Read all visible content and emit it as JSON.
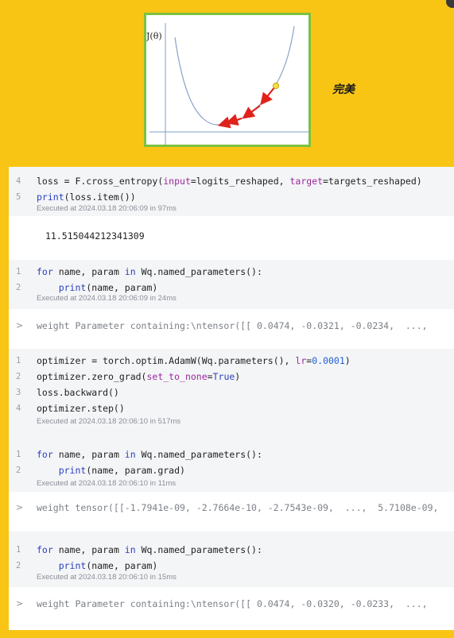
{
  "caption": "完美",
  "figure": {
    "axis_label": "J(θ)"
  },
  "cells": [
    {
      "lines": [
        {
          "n": "4",
          "tokens": [
            [
              "loss = F.cross_entropy(",
              ""
            ],
            [
              "input",
              "par"
            ],
            [
              "=logits_reshaped, ",
              ""
            ],
            [
              "target",
              "par"
            ],
            [
              "=targets_reshaped)",
              ""
            ]
          ]
        },
        {
          "n": "5",
          "tokens": [
            [
              "print",
              "fn"
            ],
            [
              "(loss.item())",
              ""
            ]
          ]
        }
      ],
      "meta": "Executed at 2024.03.18 20:06:09 in 97ms",
      "output": "11.515044212341309"
    },
    {
      "lines": [
        {
          "n": "1",
          "tokens": [
            [
              "for",
              "kw"
            ],
            [
              " name, param ",
              ""
            ],
            [
              "in",
              "kw"
            ],
            [
              " Wq.named_parameters():",
              ""
            ]
          ]
        },
        {
          "n": "2",
          "tokens": [
            [
              "    ",
              ""
            ],
            [
              "print",
              "fn"
            ],
            [
              "(name, param)",
              ""
            ]
          ]
        }
      ],
      "meta": "Executed at 2024.03.18 20:06:09 in 24ms",
      "output": "weight Parameter containing:\\ntensor([[ 0.0474, -0.0321, -0.0234,  ...,"
    },
    {
      "lines": [
        {
          "n": "1",
          "tokens": [
            [
              "optimizer = torch.optim.AdamW(Wq.parameters(), ",
              ""
            ],
            [
              "lr",
              "par"
            ],
            [
              "=",
              ""
            ],
            [
              "0.0001",
              "num"
            ],
            [
              ")",
              ""
            ]
          ]
        },
        {
          "n": "2",
          "tokens": [
            [
              "optimizer.zero_grad(",
              ""
            ],
            [
              "set_to_none",
              "par"
            ],
            [
              "=",
              ""
            ],
            [
              "True",
              "kw"
            ],
            [
              ")",
              ""
            ]
          ]
        },
        {
          "n": "3",
          "tokens": [
            [
              "loss.backward()",
              ""
            ]
          ]
        },
        {
          "n": "4",
          "tokens": [
            [
              "optimizer.step()",
              ""
            ]
          ]
        }
      ],
      "meta": "Executed at 2024.03.18 20:06:10 in 517ms",
      "output": ""
    },
    {
      "lines": [
        {
          "n": "1",
          "tokens": [
            [
              "for",
              "kw"
            ],
            [
              " name, param ",
              ""
            ],
            [
              "in",
              "kw"
            ],
            [
              " Wq.named_parameters():",
              ""
            ]
          ]
        },
        {
          "n": "2",
          "tokens": [
            [
              "    ",
              ""
            ],
            [
              "print",
              "fn"
            ],
            [
              "(name, param.grad)",
              ""
            ]
          ]
        }
      ],
      "meta": "Executed at 2024.03.18 20:06:10 in 11ms",
      "output": "weight tensor([[-1.7941e-09, -2.7664e-10, -2.7543e-09,  ...,  5.7108e-09,"
    },
    {
      "lines": [
        {
          "n": "1",
          "tokens": [
            [
              "for",
              "kw"
            ],
            [
              " name, param ",
              ""
            ],
            [
              "in",
              "kw"
            ],
            [
              " Wq.named_parameters():",
              ""
            ]
          ]
        },
        {
          "n": "2",
          "tokens": [
            [
              "    ",
              ""
            ],
            [
              "print",
              "fn"
            ],
            [
              "(name, param)",
              ""
            ]
          ]
        }
      ],
      "meta": "Executed at 2024.03.18 20:06:10 in 15ms",
      "output": "weight Parameter containing:\\ntensor([[ 0.0474, -0.0320, -0.0233,  ...,"
    }
  ],
  "colors": {
    "background": "#F8C515",
    "frame": "#7CC13F",
    "arrow": "#E0221B",
    "keyword": "#2A3FBF"
  }
}
